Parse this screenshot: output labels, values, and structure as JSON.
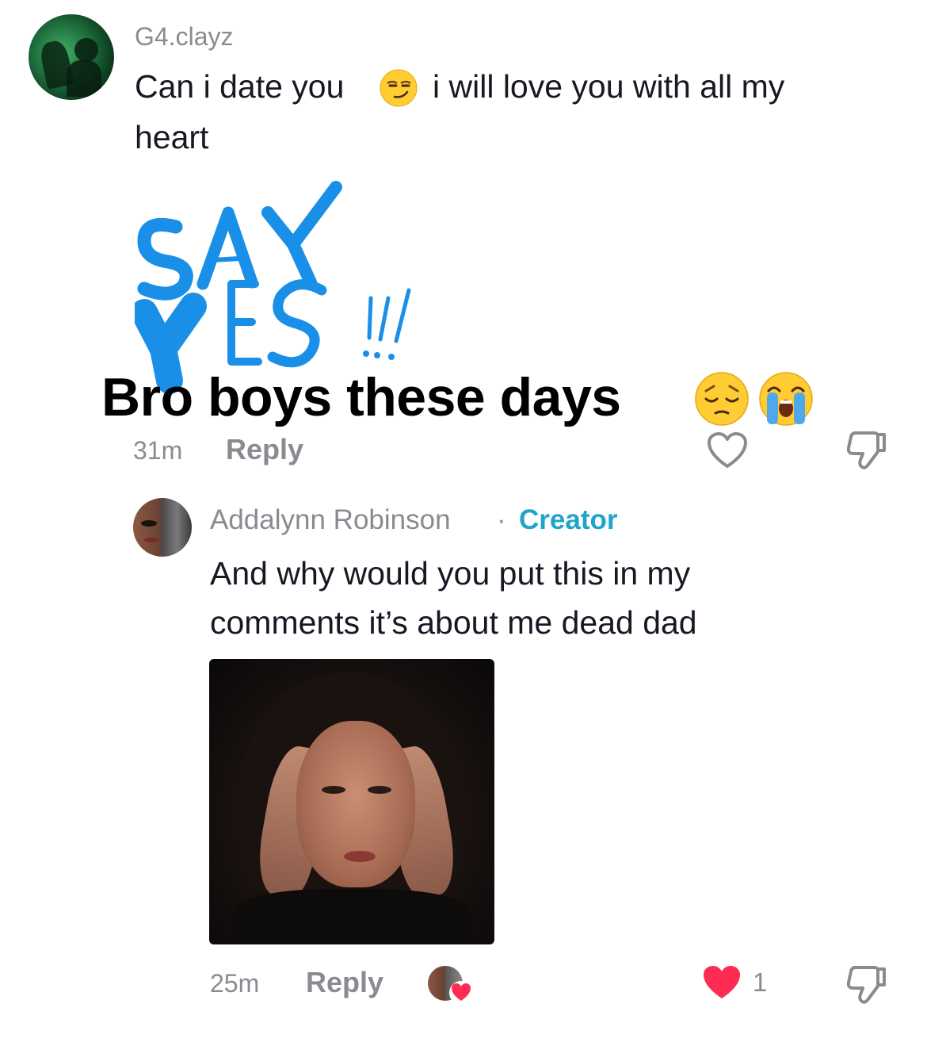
{
  "comment": {
    "username": "G4.clayz",
    "text_part1": "Can i date you",
    "text_part2": "i will love you with all my",
    "text_line2": "heart",
    "emoji_inline": "smirking-face",
    "sticker": {
      "line1": "SAY",
      "line2": "YES",
      "exclaim": "!!!",
      "color": "#1a8fe8"
    },
    "overlay_caption": "Bro boys these days",
    "overlay_emojis": [
      "pensive-face",
      "loudly-crying-face"
    ],
    "time": "31m",
    "reply_label": "Reply",
    "like_icon": "heart-outline-icon",
    "dislike_icon": "thumbs-down-icon"
  },
  "reply": {
    "username": "Addalynn Robinson",
    "separator": "·",
    "badge": "Creator",
    "badge_color": "#1ea5c9",
    "text_line1": "And why would you put this in my",
    "text_line2": "comments it’s about me dead dad",
    "time": "25m",
    "reply_label": "Reply",
    "like_count": "1",
    "like_color": "#fe2c55",
    "liked_by_creator": true,
    "like_icon": "heart-filled-icon",
    "dislike_icon": "thumbs-down-icon"
  }
}
